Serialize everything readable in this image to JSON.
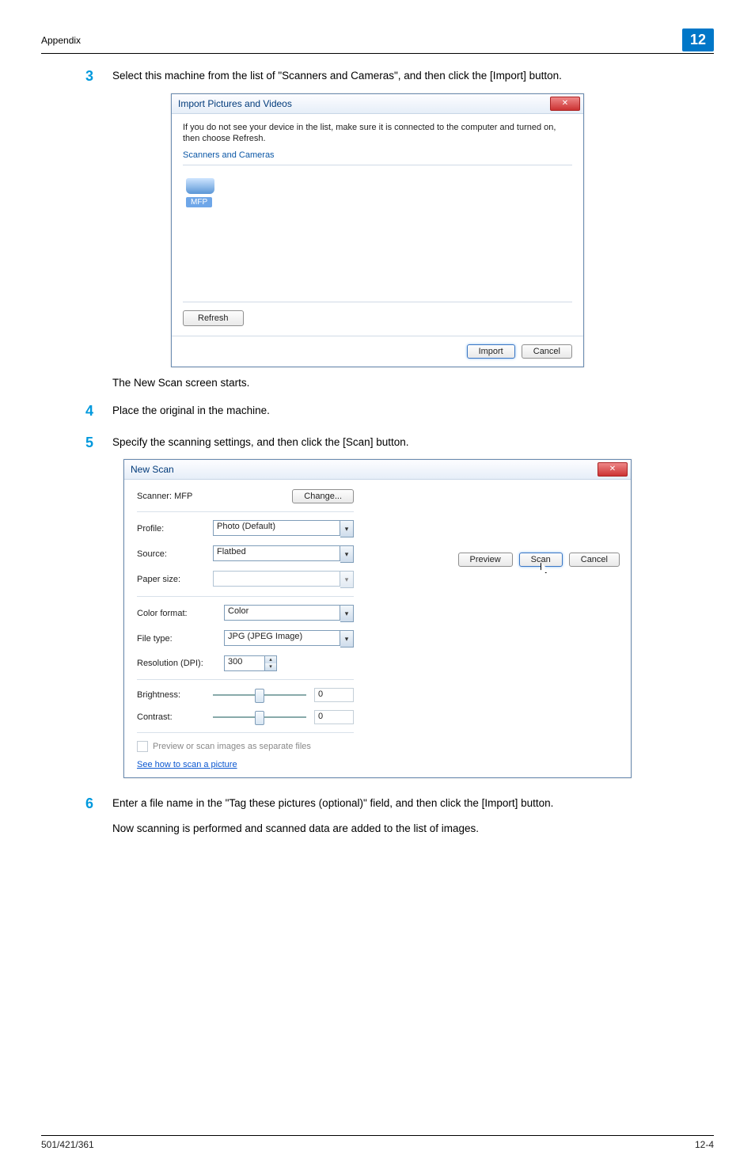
{
  "header": {
    "section": "Appendix",
    "badge": "12"
  },
  "steps": {
    "s3": {
      "num": "3",
      "text": "Select this machine from the list of \"Scanners and Cameras\", and then click the [Import] button."
    },
    "s3_after": "The New Scan screen starts.",
    "s4": {
      "num": "4",
      "text": "Place the original in the machine."
    },
    "s5": {
      "num": "5",
      "text": "Specify the scanning settings, and then click the [Scan] button."
    },
    "s6": {
      "num": "6",
      "text": "Enter a file name in the \"Tag these pictures (optional)\" field, and then click the [Import] button."
    },
    "s6_after": "Now scanning is performed and scanned data are added to the list of images."
  },
  "dialog1": {
    "title": "Import Pictures and Videos",
    "desc": "If you do not see your device in the list, make sure it is connected to the computer and turned on, then choose Refresh.",
    "group": "Scanners and Cameras",
    "item": "MFP",
    "refresh": "Refresh",
    "import": "Import",
    "cancel": "Cancel"
  },
  "dialog2": {
    "title": "New Scan",
    "scanner_label": "Scanner: MFP",
    "change": "Change...",
    "profile_label": "Profile:",
    "profile_value": "Photo (Default)",
    "source_label": "Source:",
    "source_value": "Flatbed",
    "papersize_label": "Paper size:",
    "papersize_value": "",
    "colorfmt_label": "Color format:",
    "colorfmt_value": "Color",
    "filetype_label": "File type:",
    "filetype_value": "JPG (JPEG Image)",
    "res_label": "Resolution (DPI):",
    "res_value": "300",
    "brightness_label": "Brightness:",
    "brightness_value": "0",
    "contrast_label": "Contrast:",
    "contrast_value": "0",
    "separate_label": "Preview or scan images as separate files",
    "help_link": "See how to scan a picture",
    "preview": "Preview",
    "scan": "Scan",
    "cancel": "Cancel"
  },
  "footer": {
    "left": "501/421/361",
    "right": "12-4"
  }
}
